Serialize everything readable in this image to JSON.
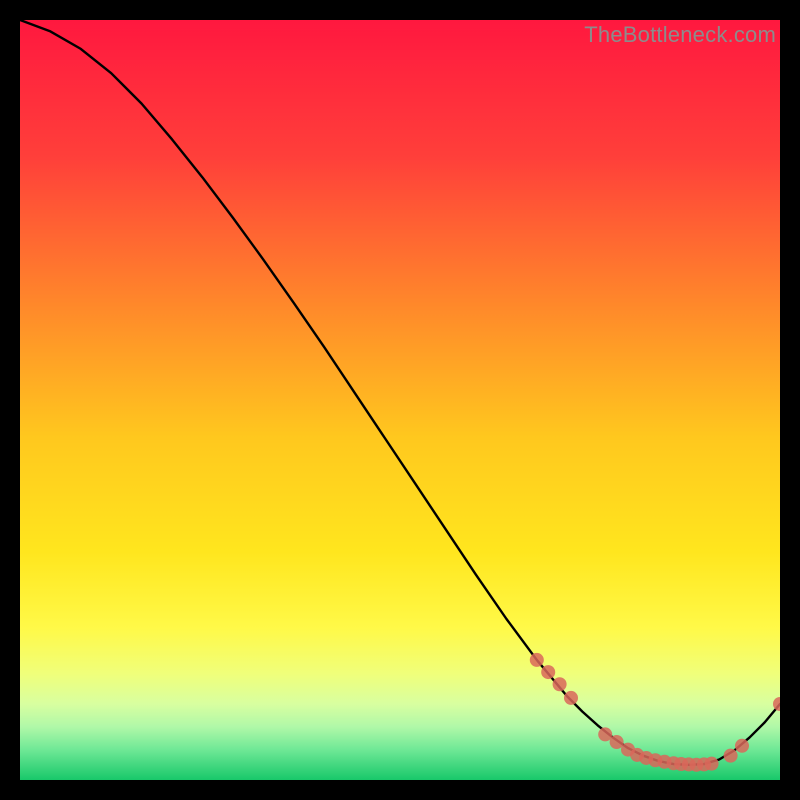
{
  "watermark": "TheBottleneck.com",
  "chart_data": {
    "type": "line",
    "title": "",
    "xlabel": "",
    "ylabel": "",
    "xlim": [
      0,
      100
    ],
    "ylim": [
      0,
      100
    ],
    "grid": false,
    "background_gradient": {
      "top_color": "#ff183f",
      "mid_color": "#ffd400",
      "bottom_colors": [
        "#f4ff8a",
        "#c7ffb0",
        "#5fe08d",
        "#18c86a"
      ]
    },
    "series": [
      {
        "name": "bottleneck-curve",
        "type": "line",
        "color": "#000000",
        "x": [
          0,
          4,
          8,
          12,
          16,
          20,
          24,
          28,
          32,
          36,
          40,
          44,
          48,
          52,
          56,
          60,
          64,
          68,
          72,
          74,
          76,
          78,
          80,
          82,
          84,
          86,
          88,
          90,
          92,
          94,
          96,
          98,
          100
        ],
        "y": [
          100,
          98.5,
          96.2,
          93.0,
          89.0,
          84.3,
          79.3,
          74.0,
          68.5,
          62.8,
          57.0,
          51.0,
          45.0,
          39.0,
          33.0,
          27.0,
          21.2,
          15.8,
          11.0,
          9.0,
          7.2,
          5.6,
          4.2,
          3.2,
          2.5,
          2.1,
          2.0,
          2.1,
          2.7,
          3.9,
          5.6,
          7.6,
          10.0
        ]
      },
      {
        "name": "data-points",
        "type": "scatter",
        "color": "#d9675b",
        "x": [
          68,
          69.5,
          71,
          72.5,
          77,
          78.5,
          80,
          81.2,
          82.4,
          83.6,
          84.8,
          86,
          87,
          88,
          89,
          90,
          91,
          93.5,
          95,
          100
        ],
        "y": [
          15.8,
          14.2,
          12.6,
          10.8,
          6.0,
          5.0,
          4.0,
          3.3,
          2.9,
          2.6,
          2.4,
          2.2,
          2.1,
          2.05,
          2.0,
          2.05,
          2.15,
          3.2,
          4.5,
          10.0
        ]
      }
    ]
  }
}
